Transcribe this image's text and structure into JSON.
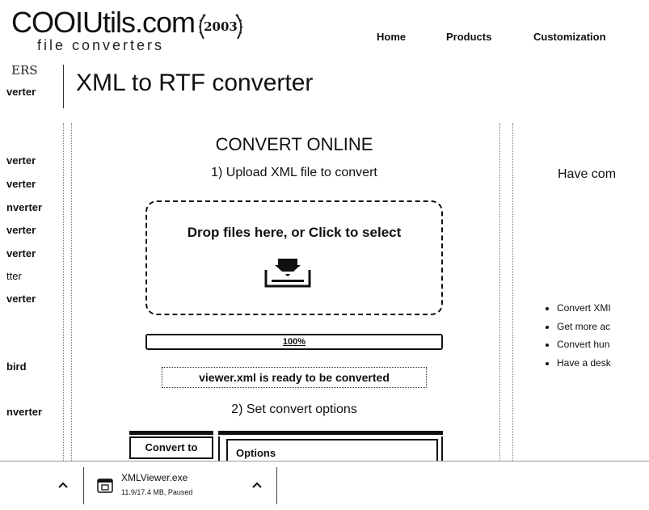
{
  "header": {
    "logo_text": "COOIUtils.com",
    "logo_tagline": "file converters",
    "seal_year": "2003",
    "nav": [
      "Home",
      "Products",
      "Customization"
    ]
  },
  "sidebar": {
    "heading": "ERS",
    "items": [
      "verter",
      "verter",
      "verter",
      "nverter",
      "verter",
      "verter",
      "tter",
      "verter",
      "bird",
      "nverter"
    ]
  },
  "page": {
    "title": "XML to RTF converter"
  },
  "converter": {
    "heading": "CONVERT ONLINE",
    "step1": "1) Upload XML file to convert",
    "drop_label": "Drop files here, or Click to select",
    "progress_text": "100%",
    "progress_value": 1.0,
    "ready_message": "viewer.xml is ready to be converted",
    "step2": "2) Set convert options",
    "convert_to_label": "Convert to",
    "options_label": "Options"
  },
  "right": {
    "heading": "Have com",
    "bullets": [
      "Convert XMI",
      "Get more ac",
      "Convert hun",
      "Have a desk"
    ]
  },
  "download": {
    "file_name": "XMLViewer.exe",
    "status": "11.9/17.4 MB, Paused"
  },
  "colors": {
    "text": "#111111",
    "background": "#ffffff",
    "border": "#111111"
  },
  "icons": [
    "seal-icon",
    "upload-icon",
    "file-icon",
    "chevron-up-icon"
  ]
}
